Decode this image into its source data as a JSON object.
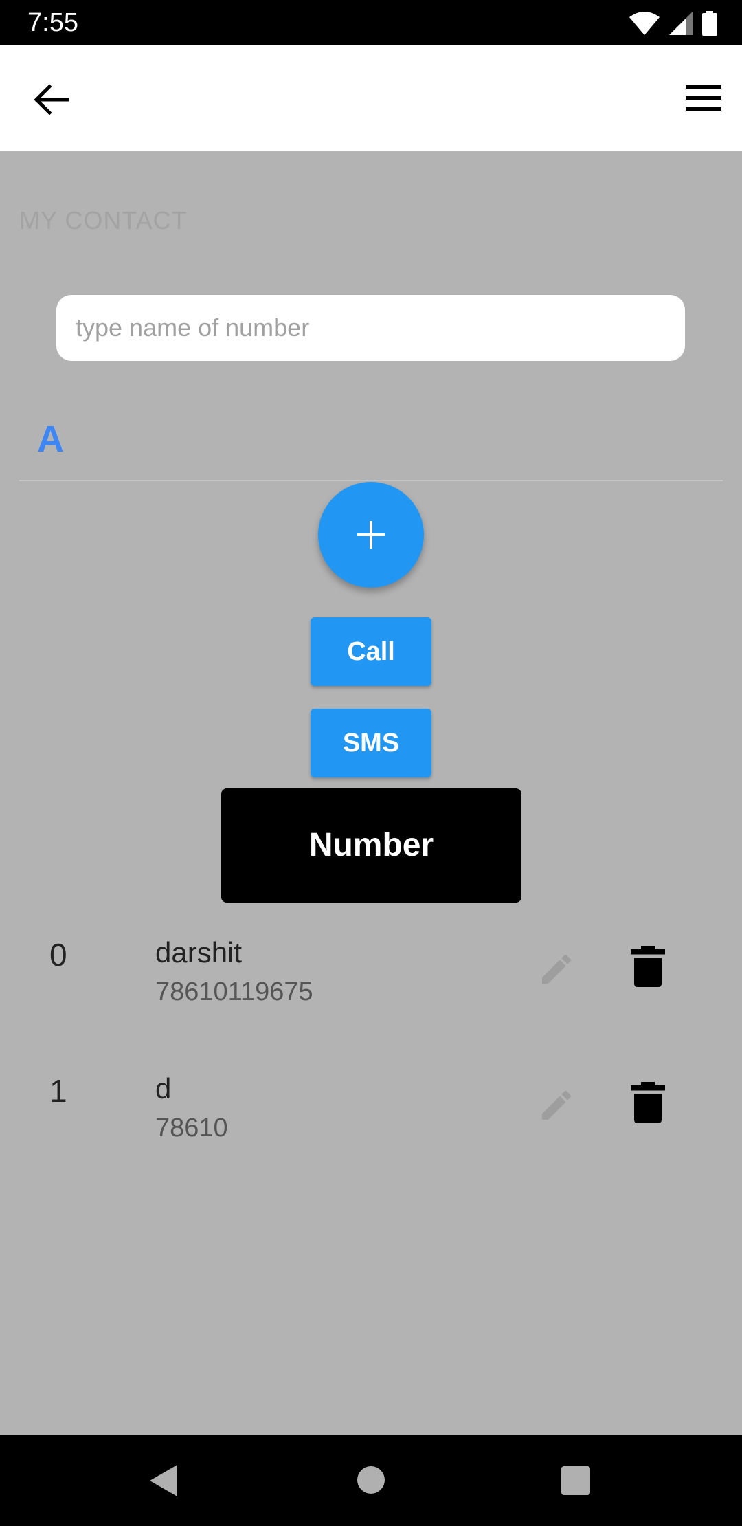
{
  "status_bar": {
    "time": "7:55",
    "icons": [
      "wifi-icon",
      "signal-icon",
      "battery-icon"
    ]
  },
  "app_bar": {
    "back_icon": "arrow-back-icon",
    "menu_icon": "hamburger-menu-icon"
  },
  "section": {
    "title": "MY CONTACT"
  },
  "search": {
    "placeholder": "type name of number",
    "value": ""
  },
  "group": {
    "letter": "A"
  },
  "fab": {
    "icon": "plus-icon"
  },
  "actions": {
    "call_label": "Call",
    "sms_label": "SMS"
  },
  "tooltip": {
    "text": "Number"
  },
  "contacts": [
    {
      "index": "0",
      "name": "darshit",
      "number": "78610119675"
    },
    {
      "index": "1",
      "name": "d",
      "number": "78610"
    }
  ],
  "colors": {
    "accent": "#2196f3",
    "group_letter": "#3d86f4",
    "overlay_background": "#b3b3b3"
  },
  "nav_bar": {
    "icons": [
      "nav-back-icon",
      "nav-home-icon",
      "nav-recents-icon"
    ]
  }
}
